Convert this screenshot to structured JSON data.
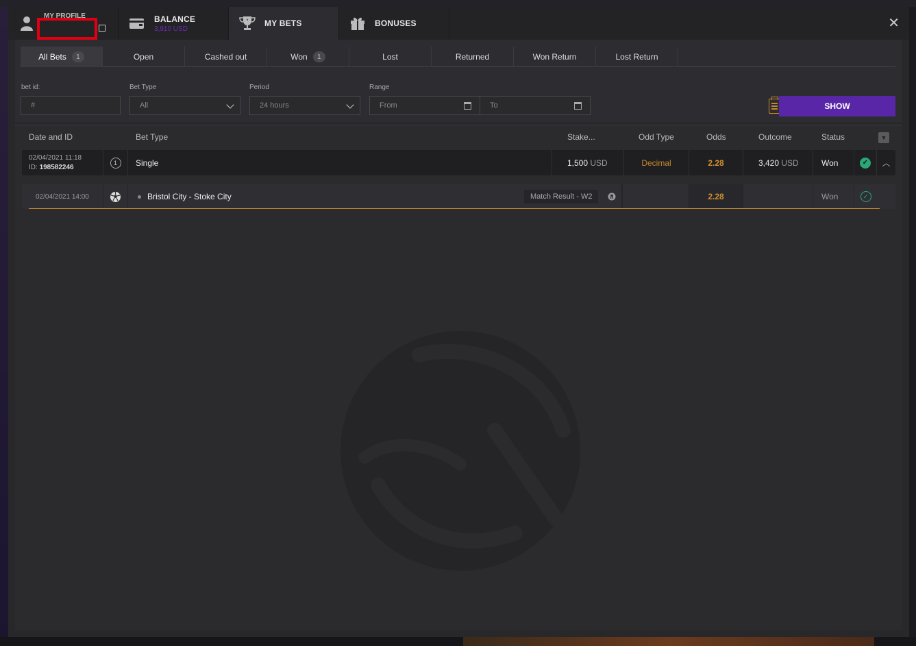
{
  "topbar": {
    "tabs": [
      {
        "label": "MY PROFILE",
        "sub": ""
      },
      {
        "label": "BALANCE",
        "sub": "3,910 USD"
      },
      {
        "label": "MY BETS",
        "sub": ""
      },
      {
        "label": "BONUSES",
        "sub": ""
      }
    ],
    "close_icon": "close-icon"
  },
  "subtabs": [
    {
      "label": "All Bets",
      "count": "1"
    },
    {
      "label": "Open",
      "count": ""
    },
    {
      "label": "Cashed out",
      "count": ""
    },
    {
      "label": "Won",
      "count": "1"
    },
    {
      "label": "Lost",
      "count": ""
    },
    {
      "label": "Returned",
      "count": ""
    },
    {
      "label": "Won Return",
      "count": ""
    },
    {
      "label": "Lost Return",
      "count": ""
    }
  ],
  "filters": {
    "bet_id_label": "bet id:",
    "bet_id_placeholder": "#",
    "bet_type_label": "Bet Type",
    "bet_type_value": "All",
    "period_label": "Period",
    "period_value": "24 hours",
    "range_label": "Range",
    "from_placeholder": "From",
    "to_placeholder": "To",
    "show_label": "SHOW"
  },
  "table": {
    "headers": {
      "date": "Date and ID",
      "bet_type": "Bet Type",
      "stake": "Stake...",
      "odd_type": "Odd Type",
      "odds": "Odds",
      "outcome": "Outcome",
      "status": "Status"
    },
    "bet": {
      "date": "02/04/2021 11:18",
      "id_label": "ID:",
      "id": "198582246",
      "count": "1",
      "type": "Single",
      "stake": "1,500",
      "stake_currency": "USD",
      "odd_type": "Decimal",
      "odds": "2.28",
      "outcome": "3,420",
      "outcome_currency": "USD",
      "status": "Won"
    },
    "selection": {
      "date": "02/04/2021 14:00",
      "event": "Bristol City - Stoke City",
      "market": "Match Result - W2",
      "odds": "2.28",
      "status": "Won"
    }
  },
  "colors": {
    "accent": "#5a26a8",
    "odds": "#d18f2a",
    "success": "#2aa876"
  }
}
